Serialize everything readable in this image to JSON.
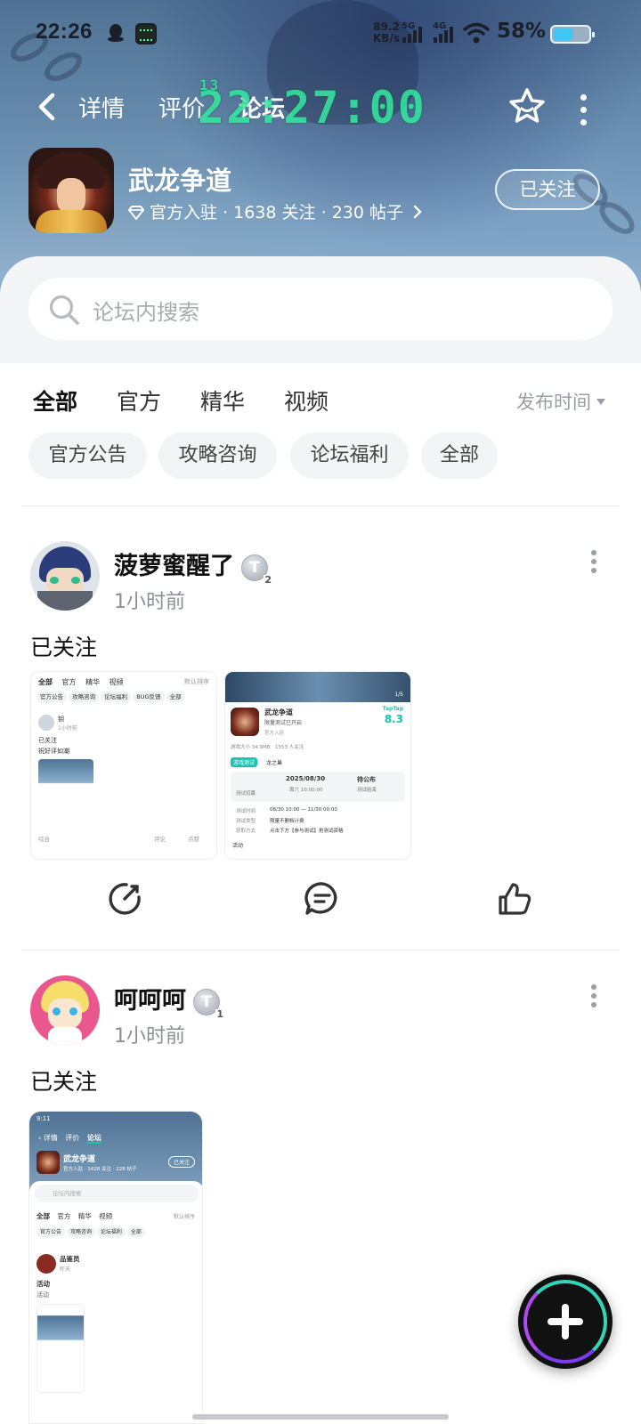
{
  "status_bar": {
    "time": "22:26",
    "net_speed_value": "89.2",
    "net_speed_unit": "KB/s",
    "net_5g": "5G",
    "net_4g": "4G",
    "battery_pct": "58%",
    "battery_level": 0.58
  },
  "navbar": {
    "tabs": [
      "详情",
      "评价",
      "论坛"
    ],
    "active_tab": "论坛",
    "clock_overlay": "22:27:00",
    "clock_small": "13"
  },
  "game": {
    "title": "武龙争道",
    "official": "官方入驻",
    "followers": "1638 关注",
    "posts": "230 帖子",
    "follow_button": "已关注"
  },
  "search": {
    "placeholder": "论坛内搜索"
  },
  "filter_tabs": [
    "全部",
    "官方",
    "精华",
    "视频"
  ],
  "sort_label": "发布时间",
  "chips": [
    "官方公告",
    "攻略咨询",
    "论坛福利",
    "全部"
  ],
  "posts": [
    {
      "user": "菠萝蜜醒了",
      "level": "T",
      "level_num": "2",
      "time": "1小时前",
      "body": "已关注",
      "thumb1": {
        "tabs": [
          "全部",
          "官方",
          "精华",
          "视频"
        ],
        "sort": "默认排序",
        "chips": [
          "官方公告",
          "攻略咨询",
          "论坛福利",
          "BUG反馈",
          "全部"
        ],
        "user": "钥",
        "time": "1小时前",
        "body1": "已关注",
        "body2": "祝好评如潮",
        "left_tag": "综合",
        "comment": "评论",
        "like": "点赞"
      },
      "thumb2": {
        "page": "1/5",
        "title": "武龙争道",
        "subtitle": "限量测试已开启",
        "official": "官方入驻",
        "brand": "TapTap",
        "score": "8.3",
        "size": "游戏大小 34.9MB",
        "installs": "1553 人关注",
        "test_tag": "游戏测试",
        "test_name": "龙之巢",
        "start_date": "2025/08/30",
        "start_time": "周六 10:00:00",
        "start_label": "测试招募",
        "end_label": "待公布",
        "end_sub": "测试结束",
        "rows": [
          [
            "测试时间",
            "08/30 10:00 — 11/30 00:00"
          ],
          [
            "测试类型",
            "限量不删档计费"
          ],
          [
            "获取方式",
            "点击下方【参与测试】抢测试资格"
          ]
        ],
        "activity": "活动"
      }
    },
    {
      "user": "呵呵呵",
      "level": "T",
      "level_num": "1",
      "time": "1小时前",
      "body": "已关注",
      "thumb": {
        "time": "9:11",
        "tabs": [
          "详情",
          "评价",
          "论坛"
        ],
        "title": "武龙争道",
        "meta": "官方入驻 · 1428 关注 · 228 帖子",
        "follow": "已关注",
        "search": "论坛内搜索",
        "ftabs": [
          "全部",
          "官方",
          "精华",
          "视频"
        ],
        "sort": "默认排序",
        "chips": [
          "官方公告",
          "攻略咨询",
          "论坛福利",
          "全部"
        ],
        "user": "品鉴员",
        "user_time": "昨天",
        "body1": "活动",
        "body2": "活动"
      }
    }
  ],
  "colors": {
    "accent": "#18c5b1",
    "header_blue": "#6e93b4",
    "clock_green": "#35e8a0",
    "fab_ring_teal": "#2fd6b8",
    "fab_ring_purple": "#7b3cf0"
  }
}
